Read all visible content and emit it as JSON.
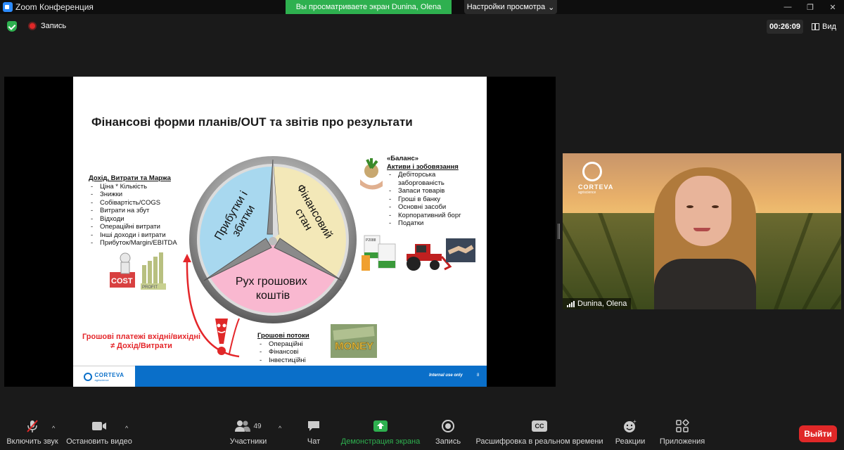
{
  "window": {
    "title": "Zoom Конференция",
    "share_banner": "Вы просматриваете экран Dunina, Olena",
    "view_settings": "Настройки просмотра"
  },
  "topbar": {
    "recording": "Запись",
    "timer": "00:26:09",
    "view": "Вид"
  },
  "slide": {
    "title": "Фінансові форми планів/OUT та звітів про результати",
    "income_block": {
      "header": "Дохід, Витрати та Маржа",
      "items": [
        "Ціна * Кількість",
        "Знижки",
        "Собівартість/COGS",
        "Витрати на збут",
        "Відходи",
        "Операційні витрати",
        "Інші доходи і витрати",
        "Прибуток/Margin/EBITDA"
      ]
    },
    "balance_block": {
      "header1": "«Баланс»",
      "header2": "Активи і зобовязання",
      "items": [
        "Дебіторська заборгованість",
        "Запаси товарів",
        "Гроші в банку",
        "Основні засоби",
        "Корпоративний борг",
        "Податки"
      ]
    },
    "cash_block": {
      "header": "Грошові потоки",
      "items": [
        "Операційні",
        "Фінансові",
        "Інвестиційні"
      ]
    },
    "wheel": {
      "segment_pl_line1": "Прибутки і",
      "segment_pl_line2": "збитки",
      "segment_fin_line1": "Фінансовий",
      "segment_fin_line2": "стан",
      "segment_cash_line1": "Рух грошових",
      "segment_cash_line2": "коштів",
      "colors": {
        "pl": "#a8d8ef",
        "fin": "#f3e8b8",
        "cash": "#f9b8d0"
      }
    },
    "red_note_line1": "Грошові платежі вхідні/вихідні",
    "red_note_line2": "≠ Дохід/Витрати",
    "footer_logo": "CORTEVA",
    "footer_logo_sub": "agriscience",
    "footer_internal": "Internal use only",
    "footer_page": "8",
    "pic_labels": {
      "cost": "COST",
      "profit": "PROFIT",
      "money": "MONEY",
      "bag": "P2088"
    }
  },
  "participant": {
    "name": "Dunina, Olena",
    "logo": "CORTEVA",
    "logo_sub": "agriscience"
  },
  "toolbar": {
    "audio": "Включить звук",
    "video": "Остановить видео",
    "participants": "Участники",
    "participants_count": "49",
    "chat": "Чат",
    "share": "Демонстрация экрана",
    "record": "Запись",
    "captions": "Расшифровка в реальном времени",
    "captions_badge": "CC",
    "reactions": "Реакции",
    "apps": "Приложения",
    "leave": "Выйти"
  }
}
